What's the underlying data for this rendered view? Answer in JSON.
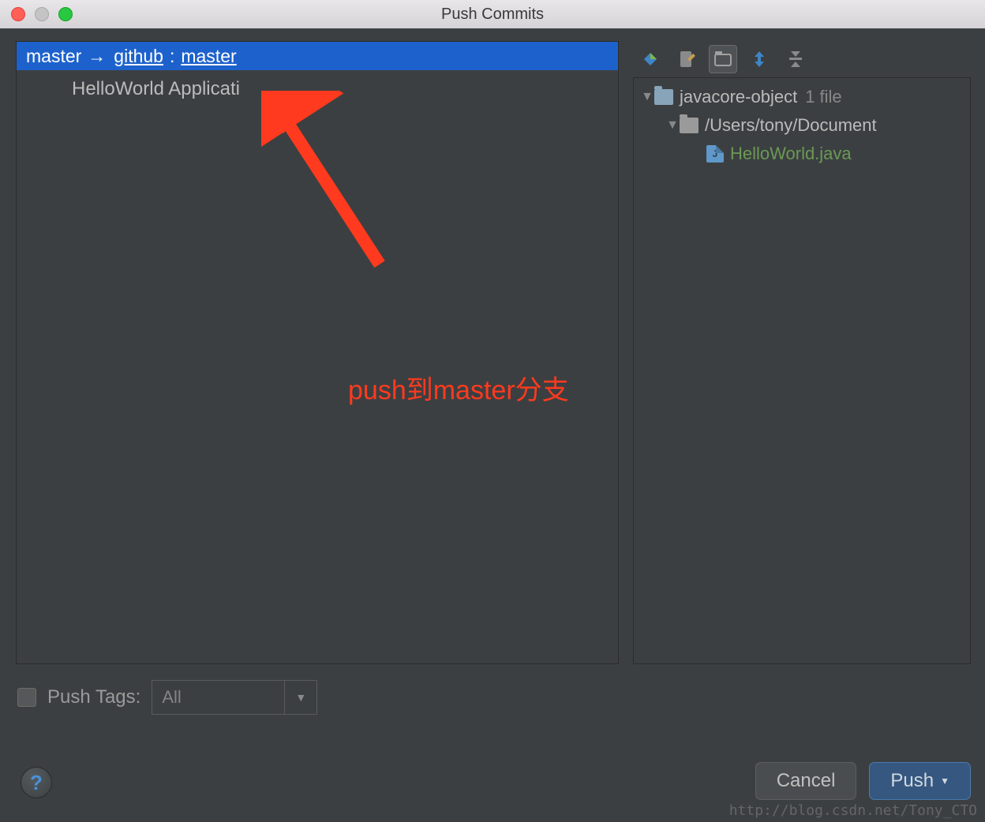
{
  "title": "Push Commits",
  "branch": {
    "local": "master",
    "arrow": "→",
    "remote": "github",
    "sep": ":",
    "remoteBranch": "master"
  },
  "commit": "HelloWorld Applicati",
  "annotation": "push到master分支",
  "tree": {
    "root": {
      "name": "javacore-object",
      "meta": "1 file"
    },
    "path": {
      "name": "/Users/tony/Document"
    },
    "file": {
      "name": "HelloWorld.java"
    }
  },
  "pushTags": {
    "label": "Push Tags:",
    "value": "All"
  },
  "buttons": {
    "cancel": "Cancel",
    "push": "Push"
  },
  "watermark": "http://blog.csdn.net/Tony_CTO"
}
